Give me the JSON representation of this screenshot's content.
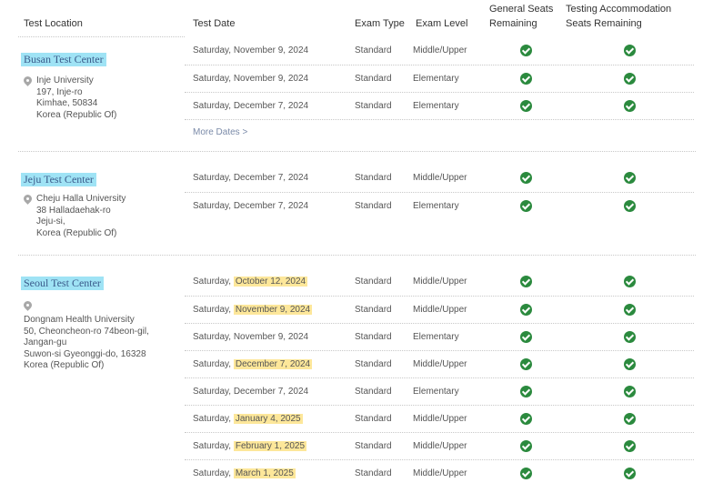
{
  "header": {
    "location": "Test Location",
    "date": "Test Date",
    "type": "Exam Type",
    "level": "Exam Level",
    "general_line1": "General Seats",
    "general_line2": "Remaining",
    "accom_line1": "Testing Accommodation",
    "accom_line2": "Seats Remaining"
  },
  "icons": {
    "check": "check-circle-icon",
    "pin": "map-pin-icon"
  },
  "colors": {
    "center_highlight": "#9fe3f5",
    "date_highlight": "#fde79a",
    "check_green": "#2b8a3e"
  },
  "busan": {
    "name": "Busan Test Center",
    "address": [
      "Inje University",
      "197, Inje-ro",
      "Kimhae, 50834",
      "Korea (Republic Of)"
    ],
    "rows": [
      {
        "prefix": "Saturday, November 9, 2024",
        "hl": "",
        "type": "Standard",
        "level": "Middle/Upper"
      },
      {
        "prefix": "Saturday, November 9, 2024",
        "hl": "",
        "type": "Standard",
        "level": "Elementary"
      },
      {
        "prefix": "Saturday, December 7, 2024",
        "hl": "",
        "type": "Standard",
        "level": "Elementary"
      }
    ],
    "more": "More Dates >"
  },
  "jeju": {
    "name": "Jeju Test Center",
    "address": [
      "Cheju Halla University",
      "38 Halladaehak-ro",
      "Jeju-si,",
      "Korea (Republic Of)"
    ],
    "rows": [
      {
        "prefix": "Saturday, December 7, 2024",
        "hl": "",
        "type": "Standard",
        "level": "Middle/Upper"
      },
      {
        "prefix": "Saturday, December 7, 2024",
        "hl": "",
        "type": "Standard",
        "level": "Elementary"
      }
    ]
  },
  "seoul": {
    "name": "Seoul Test Center",
    "address": [
      "Dongnam Health University",
      "50, Cheoncheon-ro 74beon-gil,",
      "Jangan-gu",
      "Suwon-si Gyeonggi-do, 16328",
      "Korea (Republic Of)"
    ],
    "rows": [
      {
        "prefix": "Saturday, ",
        "hl": "October 12, 2024",
        "type": "Standard",
        "level": "Middle/Upper"
      },
      {
        "prefix": "Saturday, ",
        "hl": "November 9, 2024",
        "type": "Standard",
        "level": "Middle/Upper"
      },
      {
        "prefix": "Saturday, November 9, 2024",
        "hl": "",
        "type": "Standard",
        "level": "Elementary"
      },
      {
        "prefix": "Saturday, ",
        "hl": "December 7, 2024",
        "type": "Standard",
        "level": "Middle/Upper"
      },
      {
        "prefix": "Saturday, December 7, 2024",
        "hl": "",
        "type": "Standard",
        "level": "Elementary"
      },
      {
        "prefix": "Saturday, ",
        "hl": "January 4, 2025",
        "type": "Standard",
        "level": "Middle/Upper"
      },
      {
        "prefix": "Saturday, ",
        "hl": "February 1, 2025",
        "type": "Standard",
        "level": "Middle/Upper"
      },
      {
        "prefix": "Saturday, ",
        "hl": "March 1, 2025",
        "type": "Standard",
        "level": "Middle/Upper"
      }
    ]
  }
}
